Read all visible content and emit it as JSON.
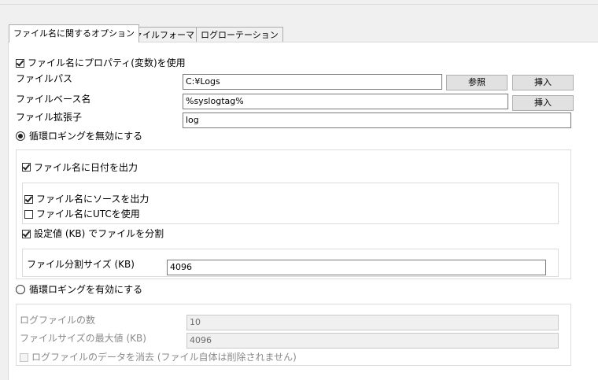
{
  "tabs": [
    "ファイル名に関するオプション",
    "ファイルフォーマット",
    "ログローテーション"
  ],
  "use_property": {
    "label": "ファイル名にプロパティ(変数)を使用",
    "checked": true
  },
  "file_path": {
    "label": "ファイルパス",
    "value": "C:¥Logs",
    "browse_label": "参照",
    "insert_label": "挿入"
  },
  "file_base": {
    "label": "ファイルベース名",
    "value": "%syslogtag%",
    "insert_label": "挿入"
  },
  "file_ext": {
    "label": "ファイル拡張子",
    "value": "log"
  },
  "circular_off": {
    "label": "循環ロギングを無効にする",
    "selected": true,
    "date_in_name": {
      "label": "ファイル名に日付を出力",
      "checked": true
    },
    "source_in_name": {
      "label": "ファイル名にソースを出力",
      "checked": true
    },
    "utc_in_name": {
      "label": "ファイル名にUTCを使用",
      "checked": false
    },
    "split_by_size": {
      "label": "設定値 (KB) でファイルを分割",
      "checked": true
    },
    "split_size": {
      "label": "ファイル分割サイズ (KB)",
      "value": "4096"
    }
  },
  "circular_on": {
    "label": "循環ロギングを有効にする",
    "selected": false,
    "log_count": {
      "label": "ログファイルの数",
      "value": "10"
    },
    "max_size": {
      "label": "ファイルサイズの最大値 (KB)",
      "value": "4096"
    },
    "clear_data": {
      "label": "ログファイルのデータを消去 (ファイル自体は削除されません)",
      "checked": false
    }
  }
}
